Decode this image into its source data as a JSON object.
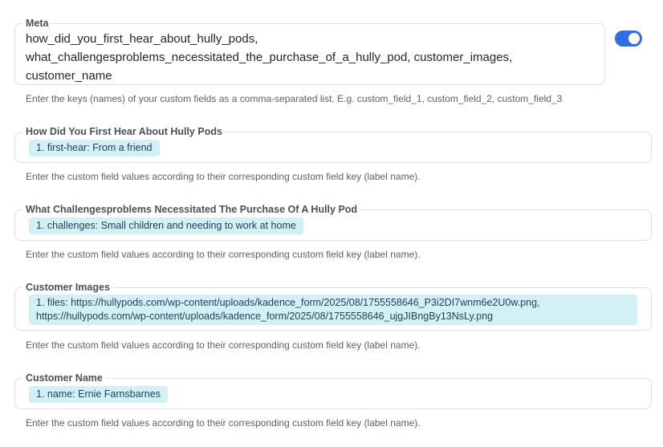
{
  "meta": {
    "label": "Meta",
    "value": "how_did_you_first_hear_about_hully_pods,\nwhat_challengesproblems_necessitated_the_purchase_of_a_hully_pod, customer_images,\ncustomer_name",
    "toggle_on": true,
    "help": "Enter the keys (names) of your custom fields as a comma-separated list. E.g. custom_field_1, custom_field_2, custom_field_3"
  },
  "fields": [
    {
      "label": "How Did You First Hear About Hully Pods",
      "value": "1. first-hear: From a friend",
      "help": "Enter the custom field values according to their corresponding custom field key (label name)."
    },
    {
      "label": "What Challengesproblems Necessitated The Purchase Of A Hully Pod",
      "value": "1. challenges: Small children and needing to work at home",
      "help": "Enter the custom field values according to their corresponding custom field key (label name)."
    },
    {
      "label": "Customer Images",
      "value": "1. files: https://hullypods.com/wp-content/uploads/kadence_form/2025/08/1755558646_P3i2DI7wnm6e2U0w.png,\nhttps://hullypods.com/wp-content/uploads/kadence_form/2025/08/1755558646_ujgJIBngBy13NsLy.png",
      "help": "Enter the custom field values according to their corresponding custom field key (label name)."
    },
    {
      "label": "Customer Name",
      "value": "1. name: Ernie Farnsbarnes",
      "help": "Enter the custom field values according to their corresponding custom field key (label name)."
    }
  ],
  "colors": {
    "accent": "#2f6fe0",
    "chip_bg": "#d3f0f7",
    "border": "#dcdfe4"
  }
}
